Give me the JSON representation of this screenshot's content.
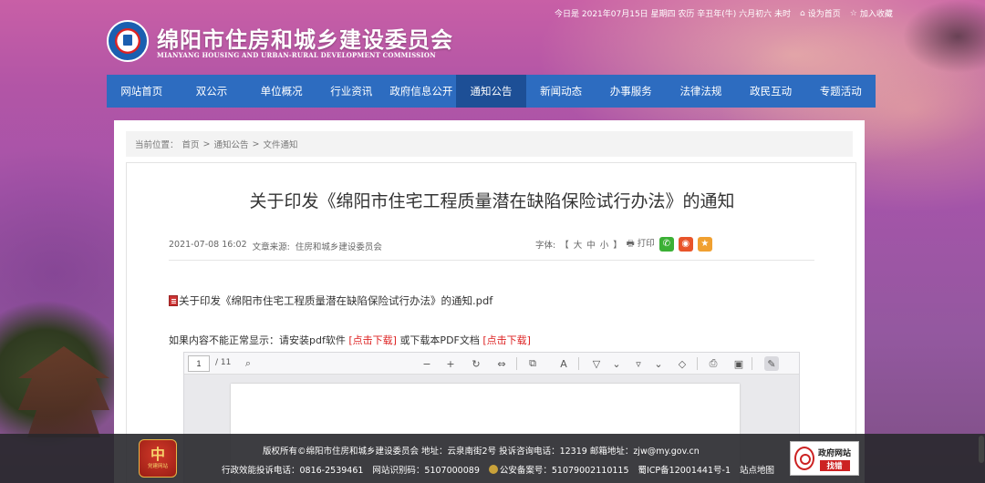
{
  "topbar": {
    "date_text": "今日是 2021年07月15日 星期四 农历 辛丑年(牛) 六月初六 未时",
    "set_home": "设为首页",
    "add_fav": "加入收藏"
  },
  "header": {
    "title": "绵阳市住房和城乡建设委员会",
    "subtitle": "MIANYANG HOUSING AND URBAN-RURAL DEVELOPMENT COMMISSION"
  },
  "nav": {
    "items": [
      "网站首页",
      "双公示",
      "单位概况",
      "行业资讯",
      "政府信息公开",
      "通知公告",
      "新闻动态",
      "办事服务",
      "法律法规",
      "政民互动",
      "专题活动"
    ],
    "active_index": 5
  },
  "breadcrumb": {
    "prefix": "当前位置：",
    "home": "首页",
    "sep": ">",
    "section": "通知公告",
    "page": "文件通知"
  },
  "article": {
    "title": "关于印发《绵阳市住宅工程质量潜在缺陷保险试行办法》的通知",
    "datetime": "2021-07-08 16:02",
    "source_label": "文章来源:",
    "source": "住房和城乡建设委员会",
    "font_label": "字体:",
    "font_open": "【",
    "font_large": "大",
    "font_medium": "中",
    "font_small": "小",
    "font_close": "】",
    "print": "打印",
    "attachment": "关于印发《绵阳市住宅工程质量潜在缺陷保险试行办法》的通知.pdf",
    "notice_before": "如果内容不能正常显示：请安装pdf软件",
    "download_software": "[点击下载]",
    "notice_mid": "或下载本PDF文档",
    "download_pdf": "[点击下载]"
  },
  "pdf_viewer": {
    "page_current": "1",
    "page_total": "/ 11"
  },
  "footer": {
    "line1": "版权所有©绵阳市住房和城乡建设委员会   地址：云泉南街2号   投诉咨询电话：12319   邮箱地址：zjw@my.gov.cn",
    "complaint": "行政效能投诉电话：0816-2539461",
    "site_code": "网站识别码：5107000089",
    "police_record": "公安备案号：51079002110115",
    "icp": "蜀ICP备12001441号-1",
    "sitemap": "站点地图",
    "badge_glyph": "中",
    "badge_text": "党建网站",
    "gov_top": "政府网站",
    "gov_bottom": "找错"
  }
}
